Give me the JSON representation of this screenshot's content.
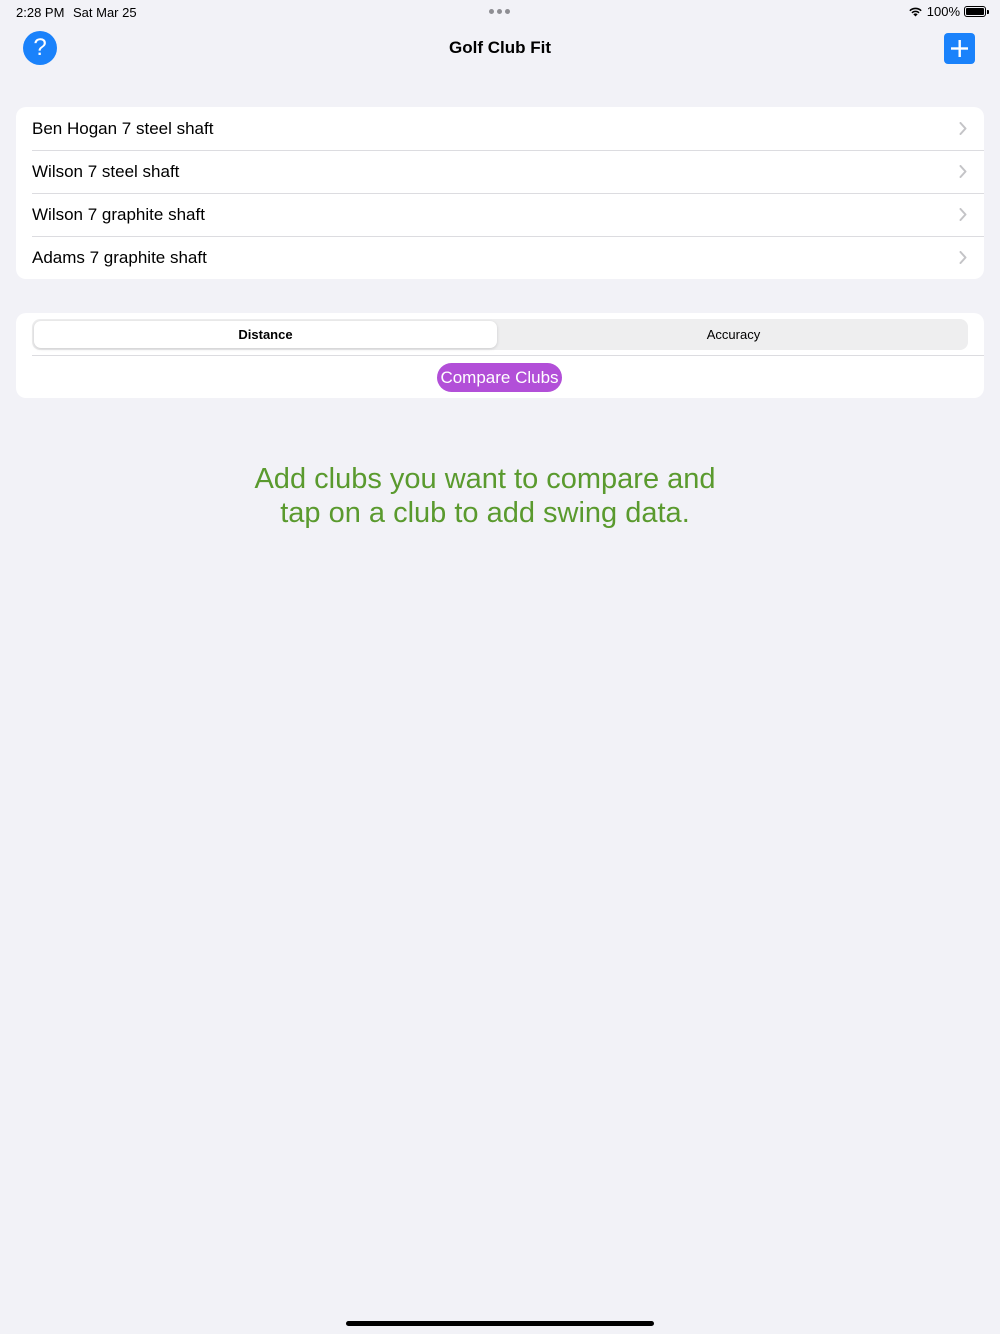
{
  "status_bar": {
    "time": "2:28 PM",
    "date": "Sat Mar 25",
    "battery": "100%"
  },
  "nav": {
    "title": "Golf Club Fit",
    "help_label": "?"
  },
  "clubs": [
    {
      "label": "Ben Hogan 7 steel shaft"
    },
    {
      "label": "Wilson 7 steel shaft"
    },
    {
      "label": "Wilson 7 graphite shaft"
    },
    {
      "label": "Adams 7 graphite shaft"
    }
  ],
  "segment": {
    "options": [
      "Distance",
      "Accuracy"
    ],
    "selected": "Distance"
  },
  "compare_button": "Compare Clubs",
  "hint": {
    "line1": "Add clubs you want to compare and",
    "line2": "tap on a club to add swing data."
  },
  "colors": {
    "accent_blue": "#1a82fb",
    "compare_purple": "#b24fd8",
    "hint_green": "#5a9a2e"
  }
}
